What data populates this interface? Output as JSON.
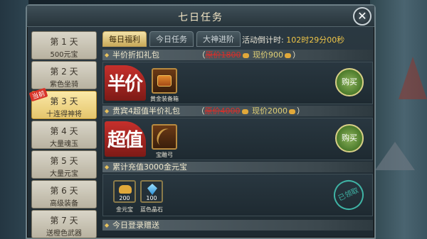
{
  "window": {
    "title": "七日任务"
  },
  "days": [
    {
      "day": "第 1 天",
      "reward": "500元宝"
    },
    {
      "day": "第 2 天",
      "reward": "紫色坐骑"
    },
    {
      "day": "第 3 天",
      "reward": "十连得神将",
      "tag": "当前"
    },
    {
      "day": "第 4 天",
      "reward": "大量魂玉"
    },
    {
      "day": "第 5 天",
      "reward": "大量元宝"
    },
    {
      "day": "第 6 天",
      "reward": "高级装备"
    },
    {
      "day": "第 7 天",
      "reward": "送橙色武器"
    }
  ],
  "tabs": [
    {
      "label": "每日福利"
    },
    {
      "label": "今日任务"
    },
    {
      "label": "大神进阶"
    }
  ],
  "countdown": {
    "label": "活动倒计时:",
    "value": "102时29分00秒"
  },
  "sections": {
    "half_price": {
      "title": "半价折扣礼包",
      "price_old": "原价1800",
      "price_new": "现价900",
      "badge": "半价",
      "item_name": "黄金装备箱",
      "buy": "购买"
    },
    "vip": {
      "title": "贵宾4超值半价礼包",
      "price_old": "原价4000",
      "price_new": "现价2000",
      "badge": "超值",
      "item_name": "宝雕弓",
      "buy": "购买"
    },
    "recharge": {
      "title": "累计充值3000金元宝",
      "items": [
        {
          "name": "金元宝",
          "count": "200"
        },
        {
          "name": "蓝色晶石",
          "count": "100"
        }
      ],
      "status": "已领取"
    },
    "login": {
      "title": "今日登录赠送"
    }
  }
}
